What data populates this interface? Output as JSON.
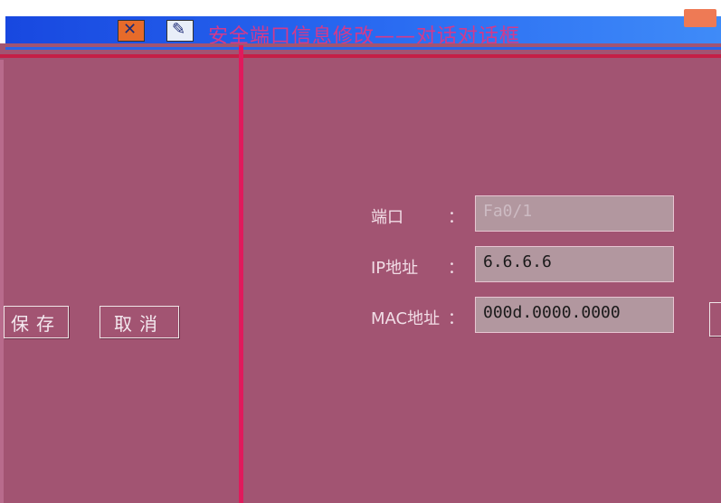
{
  "window": {
    "title": "安全端口信息修改——对话对话框"
  },
  "left": {
    "save_label": "保存",
    "cancel_label": "取消"
  },
  "form": {
    "port_label": "端口",
    "ip_label": "IP地址",
    "mac_label": "MAC地址",
    "colon": "：",
    "port_value": "Fa0/1",
    "ip_value": "6.6.6.6",
    "mac_value": "000d.0000.0000"
  },
  "colors": {
    "background": "#a25472",
    "titlebar": "#2a6cf2",
    "divider": "#e01a5c",
    "field_bg": "#b2979f"
  }
}
